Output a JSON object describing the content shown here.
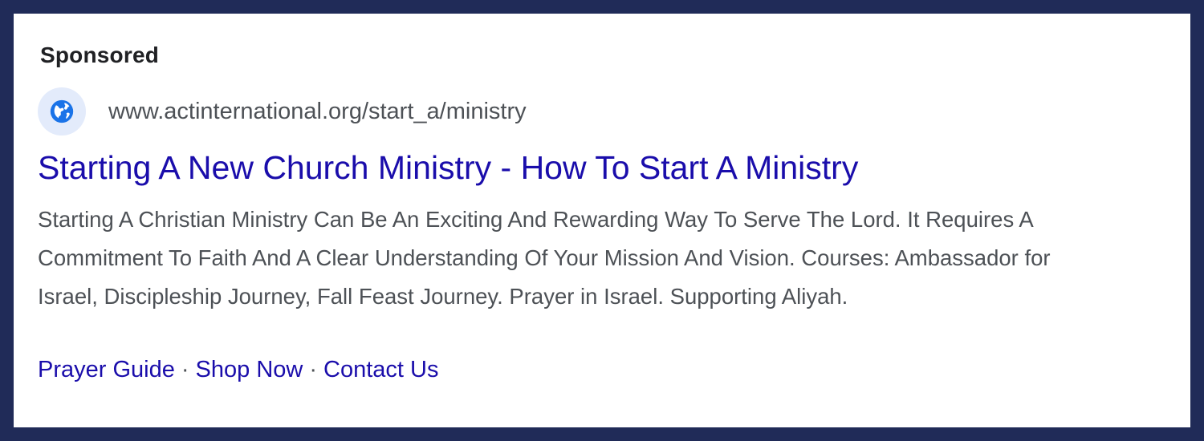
{
  "ad": {
    "sponsored_label": "Sponsored",
    "display_url": "www.actinternational.org/start_a/ministry",
    "favicon_icon": "globe-icon",
    "headline_part1": "Starting A New Church Ministry",
    "headline_separator": "-",
    "headline_part2": "How To Start A Ministry",
    "description": "Starting A Christian Ministry Can Be An Exciting And Rewarding Way To Serve The Lord. It Requires A Commitment To Faith And A Clear Understanding Of Your Mission And Vision. Courses: Ambassador for Israel, Discipleship Journey, Fall Feast Journey. Prayer in Israel. Supporting Aliyah.",
    "sitelinks": [
      {
        "label": "Prayer Guide"
      },
      {
        "label": "Shop Now"
      },
      {
        "label": "Contact Us"
      }
    ],
    "sitelink_separator": "·"
  },
  "colors": {
    "frame_border": "#202b58",
    "link_blue": "#1a0dab",
    "text_gray": "#4d5156",
    "favicon_bg": "#e3ebfb",
    "globe_blue": "#1a73e8"
  }
}
